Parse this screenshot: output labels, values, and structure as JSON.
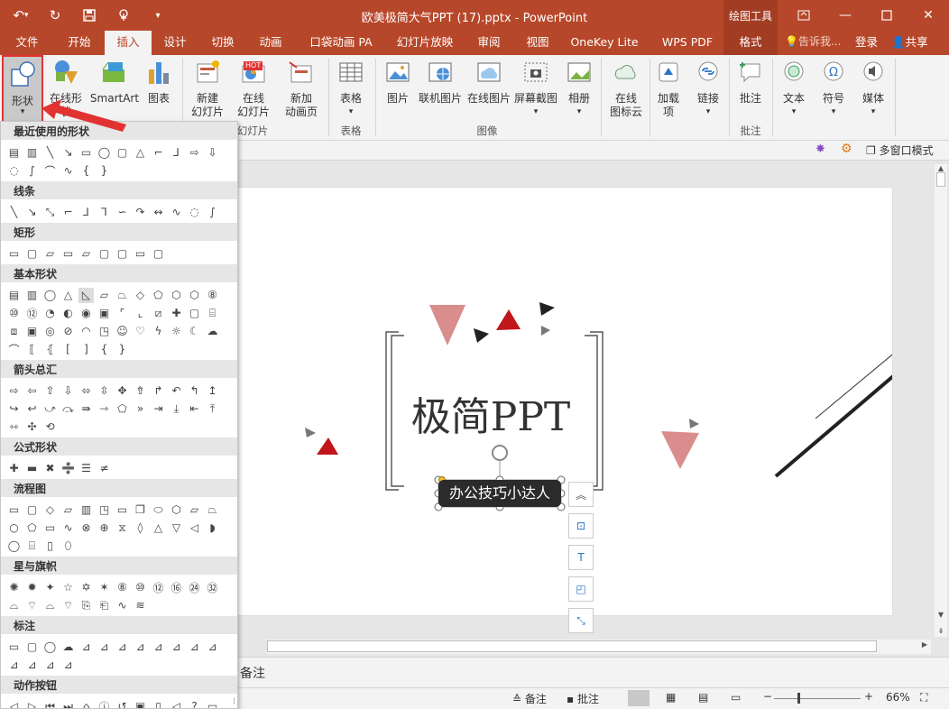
{
  "titlebar": {
    "title": "欧美极简大气PPT (17).pptx - PowerPoint",
    "context_tab": "绘图工具",
    "qat_icons": [
      "undo-icon",
      "redo-icon",
      "save-icon",
      "touch-mode-icon",
      "customize-icon"
    ]
  },
  "tabs": [
    {
      "label": "文件"
    },
    {
      "label": "开始"
    },
    {
      "label": "插入"
    },
    {
      "label": "设计"
    },
    {
      "label": "切换"
    },
    {
      "label": "动画"
    },
    {
      "label": "口袋动画 PA"
    },
    {
      "label": "幻灯片放映"
    },
    {
      "label": "审阅"
    },
    {
      "label": "视图"
    },
    {
      "label": "OneKey Lite"
    },
    {
      "label": "WPS PDF"
    },
    {
      "label": "格式"
    }
  ],
  "active_tab": "插入",
  "tell_me": "告诉我...",
  "login": "登录",
  "share": "共享",
  "ribbon": {
    "shapes": "形状",
    "online_shapes": "在线形状",
    "smartart": "SmartArt",
    "chart": "图表",
    "new_slide_1": "新建",
    "new_slide_2": "幻灯片",
    "online_slide_1": "在线",
    "online_slide_2": "幻灯片",
    "new_anim_1": "新加",
    "new_anim_2": "动画页",
    "hot": "HOT",
    "table": "表格",
    "picture": "图片",
    "online_pic": "联机图片",
    "online_picture": "在线图片",
    "screenshot": "屏幕截图",
    "album": "相册",
    "wordcloud_1": "在线",
    "wordcloud_2": "图标云",
    "addins_1": "加载",
    "addins_2": "项",
    "link": "链接",
    "comment": "批注",
    "text": "文本",
    "symbol": "符号",
    "media": "媒体",
    "group_slides": "幻灯片",
    "group_table": "表格",
    "group_images": "图像",
    "group_comments": "批注"
  },
  "subbar": {
    "multi_window": "多窗口模式"
  },
  "panel": {
    "sections": [
      {
        "title": "最近使用的形状",
        "rows": 3
      },
      {
        "title": "线条",
        "rows": 1
      },
      {
        "title": "矩形",
        "rows": 1
      },
      {
        "title": "基本形状",
        "rows": 4
      },
      {
        "title": "箭头总汇",
        "rows": 3
      },
      {
        "title": "公式形状",
        "rows": 1
      },
      {
        "title": "流程图",
        "rows": 3
      },
      {
        "title": "星与旗帜",
        "rows": 2
      },
      {
        "title": "标注",
        "rows": 2
      },
      {
        "title": "动作按钮",
        "rows": 1
      }
    ]
  },
  "slide": {
    "title": "极简PPT",
    "subtitle": "办公技巧小达人"
  },
  "notes": {
    "label": "单击此处添加备注",
    "visible": "备注"
  },
  "status": {
    "notes": "备注",
    "comments": "批注",
    "zoom": "66%"
  },
  "colors": {
    "accent": "#b7472a",
    "triangle_pink": "#d98d8d",
    "triangle_red": "#c0161c"
  }
}
